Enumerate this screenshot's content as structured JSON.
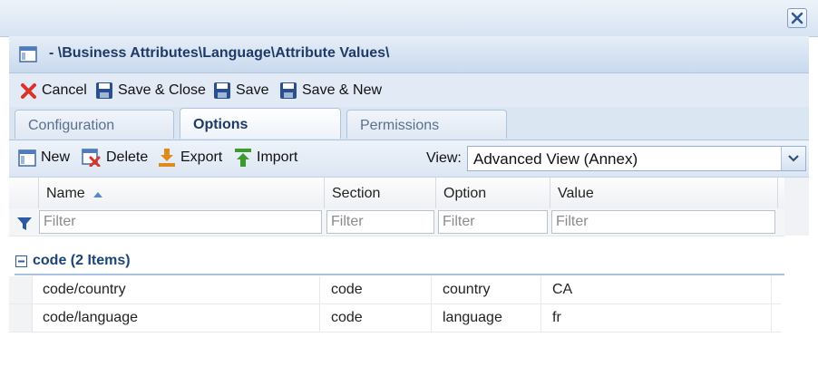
{
  "window": {
    "title": "- \\Business Attributes\\Language\\Attribute Values\\",
    "icons": {
      "close": "close-icon",
      "title": "form-icon"
    }
  },
  "toolbar": {
    "cancel_label": "Cancel",
    "save_close_label": "Save & Close",
    "save_label": "Save",
    "save_new_label": "Save & New"
  },
  "tabs": [
    {
      "label": "Configuration",
      "active": false
    },
    {
      "label": "Options",
      "active": true
    },
    {
      "label": "Permissions",
      "active": false
    }
  ],
  "grid_toolbar": {
    "new_label": "New",
    "delete_label": "Delete",
    "export_label": "Export",
    "import_label": "Import",
    "view_label": "View:",
    "view_value": "Advanced View (Annex)"
  },
  "grid": {
    "columns": [
      {
        "label": "Name",
        "sorted": "ascending"
      },
      {
        "label": "Section"
      },
      {
        "label": "Option"
      },
      {
        "label": "Value"
      }
    ],
    "filter_placeholder": "Filter",
    "group": {
      "label": "code (2 Items)",
      "expanded": true
    },
    "rows": [
      {
        "name": "code/country",
        "section": "code",
        "option": "country",
        "value": "CA"
      },
      {
        "name": "code/language",
        "section": "code",
        "option": "language",
        "value": "fr"
      }
    ]
  },
  "colors": {
    "accent": "#1d4477",
    "header_bg": "#dbe6f3",
    "cancel_icon": "#d9342b",
    "export_icon": "#e08a1e",
    "import_icon": "#3c9b2e"
  }
}
